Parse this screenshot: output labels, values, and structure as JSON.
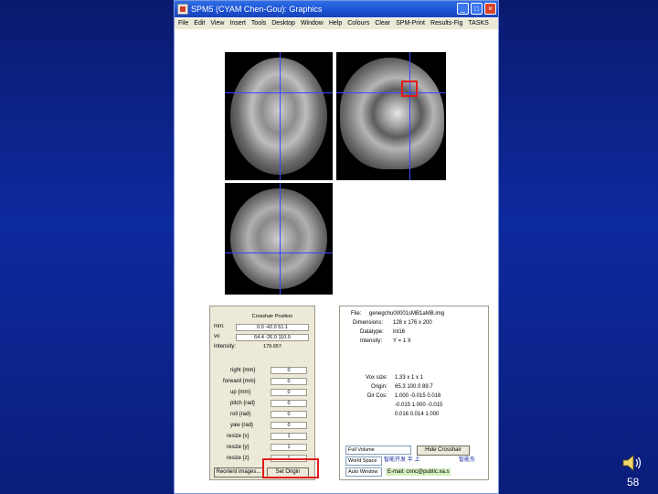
{
  "window": {
    "title": "SPM5 (CYAM Chen-Gou): Graphics",
    "buttons": {
      "minimize": "_",
      "maximize": "□",
      "close": "×"
    }
  },
  "menu": [
    "File",
    "Edit",
    "View",
    "Insert",
    "Tools",
    "Desktop",
    "Window",
    "Help",
    "Colours",
    "Clear",
    "SPM-Print",
    "Results-Fig",
    "TASKS"
  ],
  "position_panel": {
    "header": "Crosshair Position",
    "rows": [
      {
        "label": "mm:",
        "value": "0.0 -42.0 51.1"
      },
      {
        "label": "vx:",
        "value": "64.4 -26.0 110.0"
      },
      {
        "label": "Intensity:",
        "value": "179.657"
      }
    ]
  },
  "reorient_panel": {
    "rows": [
      {
        "label": "right {mm}",
        "value": "0"
      },
      {
        "label": "forward {mm}",
        "value": "0"
      },
      {
        "label": "up {mm}",
        "value": "0"
      },
      {
        "label": "pitch {rad}",
        "value": "0"
      },
      {
        "label": "roll {rad}",
        "value": "0"
      },
      {
        "label": "yaw {rad}",
        "value": "0"
      },
      {
        "label": "resize {x}",
        "value": "1"
      },
      {
        "label": "resize {y}",
        "value": "1"
      },
      {
        "label": "resize {z}",
        "value": "1"
      }
    ],
    "reorient_button": "Reorient images...",
    "set_origin_button": "Set Origin"
  },
  "info_panel": {
    "lines": [
      {
        "label": "File:",
        "value": "genegchu00001sMB1aMB.img"
      },
      {
        "label": "Dimensions:",
        "value": "128 x 176 x 200"
      },
      {
        "label": "Datatype:",
        "value": "int16"
      },
      {
        "label": "Intensity:",
        "value": "Y = 1 X"
      },
      {
        "label": "Vox size:",
        "value": "1.33 x 1 x 1"
      },
      {
        "label": "Origin:",
        "value": "65.3 100.0 89.7"
      },
      {
        "label": "Dir Cos:",
        "value": "1.000 -0.015 0.016"
      },
      {
        "label": "",
        "value": "-0.015 1.000 -0.015"
      },
      {
        "label": "",
        "value": "0.016 0.014 1.000"
      }
    ],
    "full_volume_select": "Full Volume",
    "hide_crosshair_button": "Hide Crosshair",
    "world_space_select": "World Space",
    "auto_window_select": "Auto Window",
    "chinese_note_1": "智能开发  半 上",
    "chinese_note_2": "智能东",
    "email": "E-mail: cnnc@public.xa.s"
  },
  "slide_number": "58",
  "colors": {
    "crosshair": "#3a47ff",
    "highlight": "#e21a1a",
    "background": "#0d2a9e"
  }
}
